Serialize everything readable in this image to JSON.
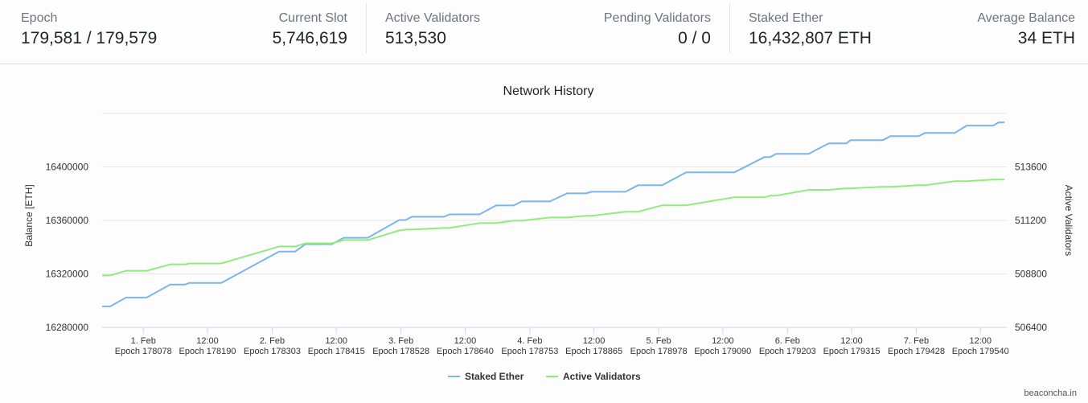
{
  "stats": {
    "epoch": {
      "label": "Epoch",
      "value": "179,581 / 179,579"
    },
    "current_slot": {
      "label": "Current Slot",
      "value": "5,746,619"
    },
    "active_validators": {
      "label": "Active Validators",
      "value": "513,530"
    },
    "pending_validators": {
      "label": "Pending Validators",
      "value": "0 / 0"
    },
    "staked_ether": {
      "label": "Staked Ether",
      "value": "16,432,807 ETH"
    },
    "average_balance": {
      "label": "Average Balance",
      "value": "34 ETH"
    }
  },
  "credit": "beaconcha.in",
  "chart_data": {
    "type": "line",
    "title": "Network History",
    "xlabel": "",
    "ylabel": "Balance [ETH]",
    "y2label": "Active Validators",
    "ylim": [
      16280000,
      16440000
    ],
    "y2lim": [
      506400,
      516000
    ],
    "yticks": [
      "16280000",
      "16320000",
      "16360000",
      "16400000"
    ],
    "y2ticks": [
      "506400",
      "508800",
      "511200",
      "513600"
    ],
    "xlim": [
      178006,
      179586
    ],
    "xticks": [
      {
        "epoch": 178078,
        "label": "1. Feb",
        "sublabel": "Epoch 178078"
      },
      {
        "epoch": 178190,
        "label": "12:00",
        "sublabel": "Epoch 178190"
      },
      {
        "epoch": 178303,
        "label": "2. Feb",
        "sublabel": "Epoch 178303"
      },
      {
        "epoch": 178415,
        "label": "12:00",
        "sublabel": "Epoch 178415"
      },
      {
        "epoch": 178528,
        "label": "3. Feb",
        "sublabel": "Epoch 178528"
      },
      {
        "epoch": 178640,
        "label": "12:00",
        "sublabel": "Epoch 178640"
      },
      {
        "epoch": 178753,
        "label": "4. Feb",
        "sublabel": "Epoch 178753"
      },
      {
        "epoch": 178865,
        "label": "12:00",
        "sublabel": "Epoch 178865"
      },
      {
        "epoch": 178978,
        "label": "5. Feb",
        "sublabel": "Epoch 178978"
      },
      {
        "epoch": 179090,
        "label": "12:00",
        "sublabel": "Epoch 179090"
      },
      {
        "epoch": 179203,
        "label": "6. Feb",
        "sublabel": "Epoch 179203"
      },
      {
        "epoch": 179315,
        "label": "12:00",
        "sublabel": "Epoch 179315"
      },
      {
        "epoch": 179428,
        "label": "7. Feb",
        "sublabel": "Epoch 179428"
      },
      {
        "epoch": 179540,
        "label": "12:00",
        "sublabel": "Epoch 179540"
      }
    ],
    "grid": true,
    "legend": "bottom-center",
    "x": [
      178006,
      178020,
      178048,
      178084,
      178125,
      178151,
      178158,
      178214,
      178315,
      178343,
      178361,
      178407,
      178428,
      178470,
      178525,
      178536,
      178547,
      178603,
      178613,
      178665,
      178694,
      178725,
      178739,
      178788,
      178818,
      178851,
      178861,
      178920,
      178942,
      178984,
      179026,
      179110,
      179163,
      179173,
      179183,
      179240,
      179275,
      179306,
      179313,
      179369,
      179383,
      179432,
      179443,
      179495,
      179516,
      179562,
      179572,
      179582
    ],
    "series": [
      {
        "name": "Staked Ether",
        "axis": "left",
        "color": "#7cb5ec",
        "values": [
          16295700,
          16295700,
          16302300,
          16302300,
          16312000,
          16312000,
          16313200,
          16313200,
          16336700,
          16336700,
          16342200,
          16342200,
          16347000,
          16347000,
          16360300,
          16360300,
          16362700,
          16362700,
          16364500,
          16364500,
          16371200,
          16371200,
          16374200,
          16374200,
          16380200,
          16380200,
          16381400,
          16381400,
          16386300,
          16386300,
          16395900,
          16395900,
          16407400,
          16407400,
          16409800,
          16409800,
          16417600,
          16417600,
          16420000,
          16420000,
          16423000,
          16423000,
          16425400,
          16425400,
          16430900,
          16430900,
          16433300,
          16433300
        ]
      },
      {
        "name": "Active Validators",
        "axis": "right",
        "color": "#90ed7d",
        "values": [
          508730,
          508730,
          508940,
          508940,
          509230,
          509230,
          509270,
          509270,
          510030,
          510030,
          510170,
          510170,
          510320,
          510320,
          510750,
          510790,
          510790,
          510860,
          510860,
          511080,
          511080,
          511190,
          511190,
          511330,
          511330,
          511410,
          511410,
          511590,
          511590,
          511880,
          511880,
          512240,
          512240,
          512310,
          512310,
          512570,
          512570,
          512640,
          512640,
          512710,
          512710,
          512780,
          512780,
          512960,
          512960,
          513030,
          513030,
          513030
        ]
      }
    ]
  }
}
